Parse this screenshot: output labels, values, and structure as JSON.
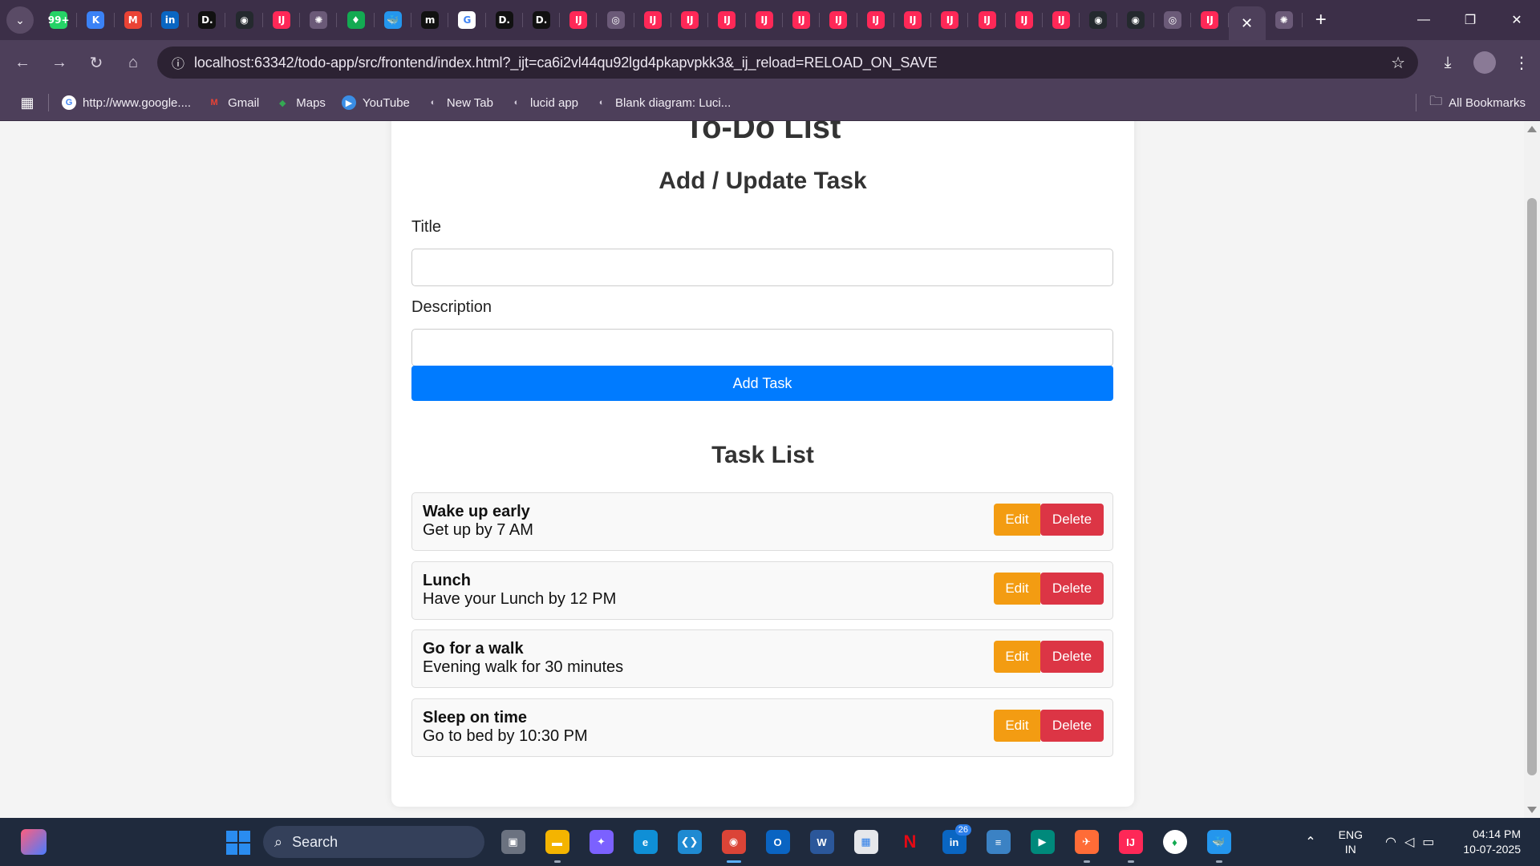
{
  "browser": {
    "tabs": [
      {
        "icon": "whatsapp-icon",
        "color": "#25d366",
        "glyph": "99+"
      },
      {
        "icon": "k-icon",
        "color": "#3b82f6",
        "glyph": "K"
      },
      {
        "icon": "gmail-icon",
        "color": "#ea4335",
        "glyph": "M"
      },
      {
        "icon": "linkedin-icon",
        "color": "#0a66c2",
        "glyph": "in"
      },
      {
        "icon": "d-icon",
        "color": "#111111",
        "glyph": "D."
      },
      {
        "icon": "github-icon",
        "color": "#24292e",
        "glyph": "◉"
      },
      {
        "icon": "intellij-icon",
        "color": "#fe2857",
        "glyph": "IJ"
      },
      {
        "icon": "openai-icon",
        "color": "#6b5a78",
        "glyph": "✺"
      },
      {
        "icon": "mongodb-icon",
        "color": "#13aa52",
        "glyph": "♦"
      },
      {
        "icon": "docker-icon",
        "color": "#2496ed",
        "glyph": "🐳"
      },
      {
        "icon": "m-icon",
        "color": "#111111",
        "glyph": "m"
      },
      {
        "icon": "google-icon",
        "color": "#ffffff",
        "glyph": "G"
      },
      {
        "icon": "d-icon",
        "color": "#111111",
        "glyph": "D."
      },
      {
        "icon": "d-icon",
        "color": "#111111",
        "glyph": "D."
      },
      {
        "icon": "intellij-icon",
        "color": "#fe2857",
        "glyph": "IJ"
      },
      {
        "icon": "chrome-icon",
        "color": "#6b5a78",
        "glyph": "◎"
      },
      {
        "icon": "intellij-icon",
        "color": "#fe2857",
        "glyph": "IJ"
      },
      {
        "icon": "intellij-icon",
        "color": "#fe2857",
        "glyph": "IJ"
      },
      {
        "icon": "intellij-icon",
        "color": "#fe2857",
        "glyph": "IJ"
      },
      {
        "icon": "intellij-icon",
        "color": "#fe2857",
        "glyph": "IJ"
      },
      {
        "icon": "intellij-icon",
        "color": "#fe2857",
        "glyph": "IJ"
      },
      {
        "icon": "intellij-icon",
        "color": "#fe2857",
        "glyph": "IJ"
      },
      {
        "icon": "intellij-icon",
        "color": "#fe2857",
        "glyph": "IJ"
      },
      {
        "icon": "intellij-icon",
        "color": "#fe2857",
        "glyph": "IJ"
      },
      {
        "icon": "intellij-icon",
        "color": "#fe2857",
        "glyph": "IJ"
      },
      {
        "icon": "intellij-icon",
        "color": "#fe2857",
        "glyph": "IJ"
      },
      {
        "icon": "intellij-icon",
        "color": "#fe2857",
        "glyph": "IJ"
      },
      {
        "icon": "intellij-icon",
        "color": "#fe2857",
        "glyph": "IJ"
      },
      {
        "icon": "github-icon",
        "color": "#24292e",
        "glyph": "◉"
      },
      {
        "icon": "github-icon",
        "color": "#24292e",
        "glyph": "◉"
      },
      {
        "icon": "chrome-icon",
        "color": "#6b5a78",
        "glyph": "◎"
      },
      {
        "icon": "intellij-icon",
        "color": "#fe2857",
        "glyph": "IJ"
      }
    ],
    "after_active_tab": {
      "icon": "openai-icon",
      "color": "#6b5a78",
      "glyph": "✺"
    },
    "url": "localhost:63342/todo-app/src/frontend/index.html?_ijt=ca6i2vl44qu92lgd4pkapvpkk3&_ij_reload=RELOAD_ON_SAVE",
    "bookmarks": [
      {
        "label": "http://www.google....",
        "icon": "google-icon",
        "color": "#ffffff",
        "glyph": "G",
        "glyph_color": "#4285f4"
      },
      {
        "label": "Gmail",
        "icon": "gmail-icon",
        "color": "transparent",
        "glyph": "M",
        "glyph_color": "#ea4335"
      },
      {
        "label": "Maps",
        "icon": "maps-icon",
        "color": "transparent",
        "glyph": "◆",
        "glyph_color": "#34a853"
      },
      {
        "label": "YouTube",
        "icon": "youtube-icon",
        "color": "#3a8ee6",
        "glyph": "▶",
        "glyph_color": "#ffffff"
      },
      {
        "label": "New Tab",
        "icon": "globe-icon",
        "color": "transparent",
        "glyph": "◐",
        "glyph_color": "#d0c8d8"
      },
      {
        "label": "lucid app",
        "icon": "globe-icon",
        "color": "transparent",
        "glyph": "◐",
        "glyph_color": "#d0c8d8"
      },
      {
        "label": "Blank diagram: Luci...",
        "icon": "globe-icon",
        "color": "transparent",
        "glyph": "◐",
        "glyph_color": "#d0c8d8"
      }
    ],
    "all_bookmarks_label": "All Bookmarks"
  },
  "page": {
    "title": "To-Do List",
    "form_heading": "Add / Update Task",
    "title_label": "Title",
    "title_value": "",
    "description_label": "Description",
    "description_value": "",
    "add_button": "Add Task",
    "list_heading": "Task List",
    "edit_label": "Edit",
    "delete_label": "Delete",
    "tasks": [
      {
        "title": "Wake up early",
        "description": "Get up by 7 AM"
      },
      {
        "title": "Lunch",
        "description": "Have your Lunch by 12 PM"
      },
      {
        "title": "Go for a walk",
        "description": "Evening walk for 30 minutes"
      },
      {
        "title": "Sleep on time",
        "description": "Go to bed by 10:30 PM"
      }
    ],
    "colors": {
      "primary": "#007bff",
      "edit": "#f39c12",
      "delete": "#dc3545"
    }
  },
  "taskbar": {
    "search_label": "Search",
    "apps": [
      {
        "icon": "task-view-icon",
        "color": "#6b7280",
        "glyph": "▣",
        "running": false
      },
      {
        "icon": "file-explorer-icon",
        "color": "#f4b400",
        "glyph": "▬",
        "running": true
      },
      {
        "icon": "copilot-icon",
        "color": "#7b61ff",
        "glyph": "✦",
        "running": false
      },
      {
        "icon": "edge-icon",
        "color": "#0f8fd6",
        "glyph": "e",
        "running": false
      },
      {
        "icon": "vscode-icon",
        "color": "#1f8ad2",
        "glyph": "❮❯",
        "running": false
      },
      {
        "icon": "chrome-icon",
        "color": "#db4437",
        "glyph": "◉",
        "running": true,
        "active": true
      },
      {
        "icon": "outlook-icon",
        "color": "#0a64c2",
        "glyph": "O",
        "running": false
      },
      {
        "icon": "word-icon",
        "color": "#2b579a",
        "glyph": "W",
        "running": false
      },
      {
        "icon": "store-icon",
        "color": "#e5e7eb",
        "glyph": "▦",
        "running": false
      },
      {
        "icon": "netflix-icon",
        "color": "transparent",
        "glyph": "N",
        "running": false
      },
      {
        "icon": "linkedin-icon",
        "color": "#0a66c2",
        "glyph": "in",
        "running": false,
        "badge": "26"
      },
      {
        "icon": "notepad-icon",
        "color": "#3b82c4",
        "glyph": "≡",
        "running": false
      },
      {
        "icon": "meet-icon",
        "color": "#00897b",
        "glyph": "▶",
        "running": false
      },
      {
        "icon": "postman-icon",
        "color": "#ff6c37",
        "glyph": "✈",
        "running": true
      },
      {
        "icon": "intellij-icon",
        "color": "#fe2857",
        "glyph": "IJ",
        "running": true
      },
      {
        "icon": "mongodb-icon",
        "color": "#ffffff",
        "glyph": "♦",
        "running": false
      },
      {
        "icon": "docker-icon",
        "color": "#2496ed",
        "glyph": "🐳",
        "running": true
      }
    ],
    "lang_line1": "ENG",
    "lang_line2": "IN",
    "time": "04:14 PM",
    "date": "10-07-2025"
  }
}
